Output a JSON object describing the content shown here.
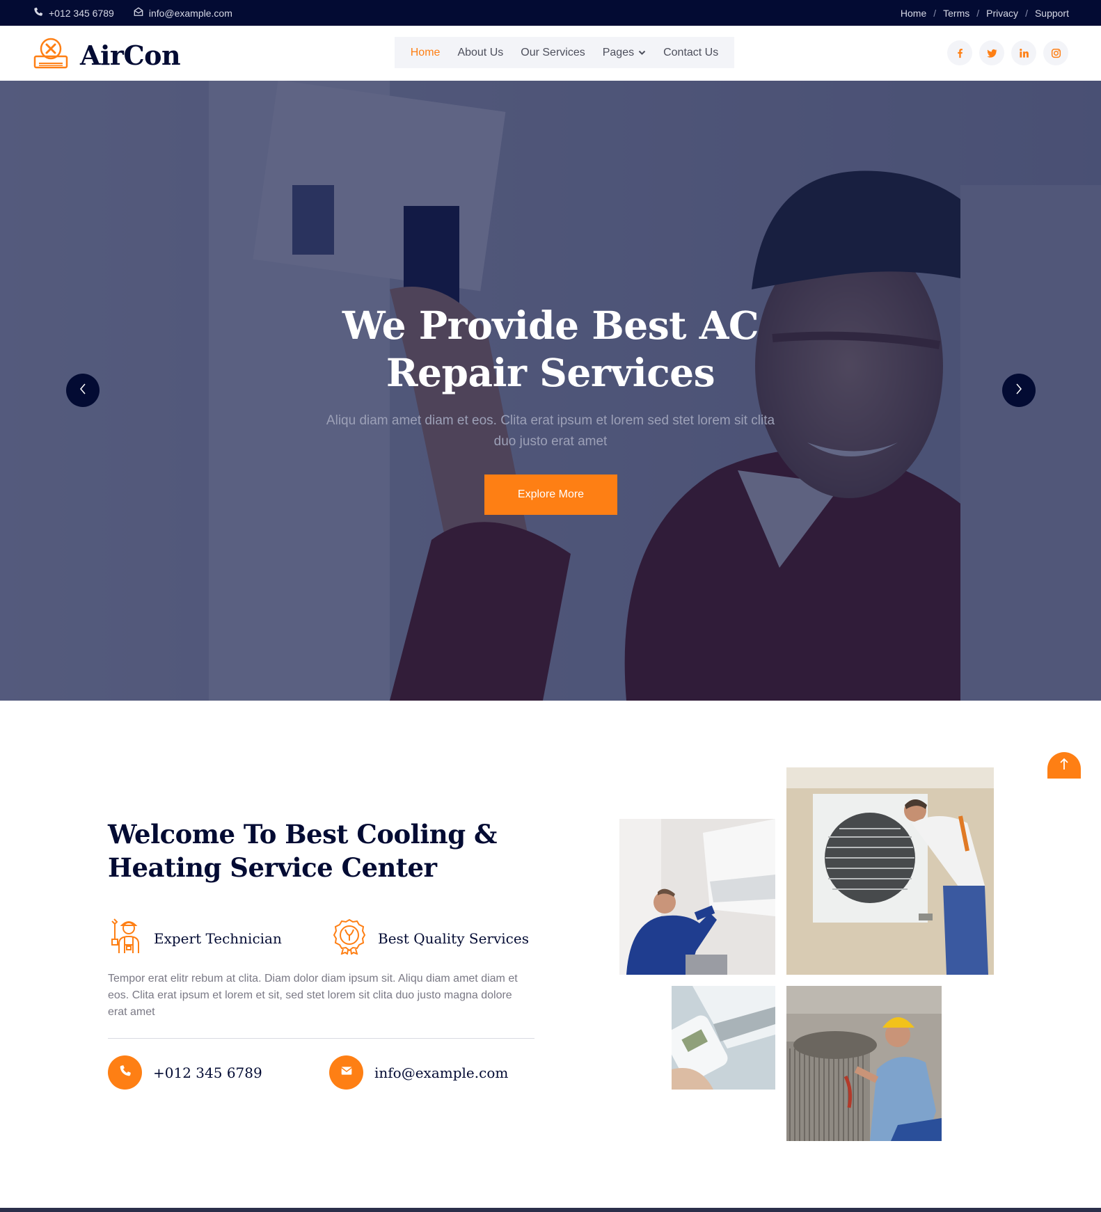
{
  "topbar": {
    "phone": "+012 345 6789",
    "email": "info@example.com",
    "links": [
      "Home",
      "Terms",
      "Privacy",
      "Support"
    ],
    "separator": "/"
  },
  "brand": {
    "name": "AirCon",
    "accent": "#fe7f14",
    "dark": "#030b33"
  },
  "nav": {
    "items": [
      {
        "label": "Home",
        "active": true
      },
      {
        "label": "About Us",
        "active": false
      },
      {
        "label": "Our Services",
        "active": false
      },
      {
        "label": "Pages",
        "active": false,
        "dropdown": true
      },
      {
        "label": "Contact Us",
        "active": false
      }
    ]
  },
  "social": {
    "icons": [
      "facebook-icon",
      "twitter-icon",
      "linkedin-icon",
      "instagram-icon"
    ]
  },
  "hero": {
    "title": "We Provide Best AC Repair Services",
    "subtitle": "Aliqu diam amet diam et eos. Clita erat ipsum et lorem sed stet lorem sit clita duo justo erat amet",
    "button": "Explore More"
  },
  "welcome": {
    "title": "Welcome To Best Cooling & Heating Service Center",
    "features": [
      {
        "icon": "technician-icon",
        "label": "Expert Technician"
      },
      {
        "icon": "quality-badge-icon",
        "label": "Best Quality Services"
      }
    ],
    "body": "Tempor erat elitr rebum at clita. Diam dolor diam ipsum sit. Aliqu diam amet diam et eos. Clita erat ipsum et lorem et sit, sed stet lorem sit clita duo justo magna dolore erat amet",
    "phone": "+012 345 6789",
    "email": "info@example.com"
  }
}
